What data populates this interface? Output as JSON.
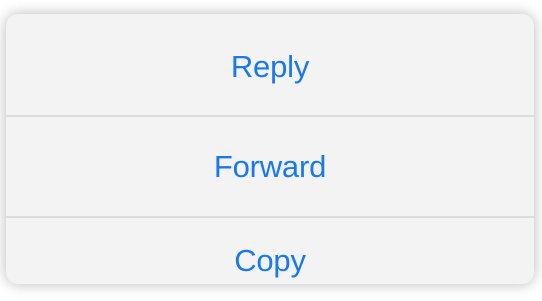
{
  "menu": {
    "items": [
      {
        "label": "Reply"
      },
      {
        "label": "Forward"
      },
      {
        "label": "Copy"
      }
    ],
    "colors": {
      "text": "#1a78ee",
      "background": "#f3f3f3",
      "divider": "#dcdcdc"
    }
  }
}
